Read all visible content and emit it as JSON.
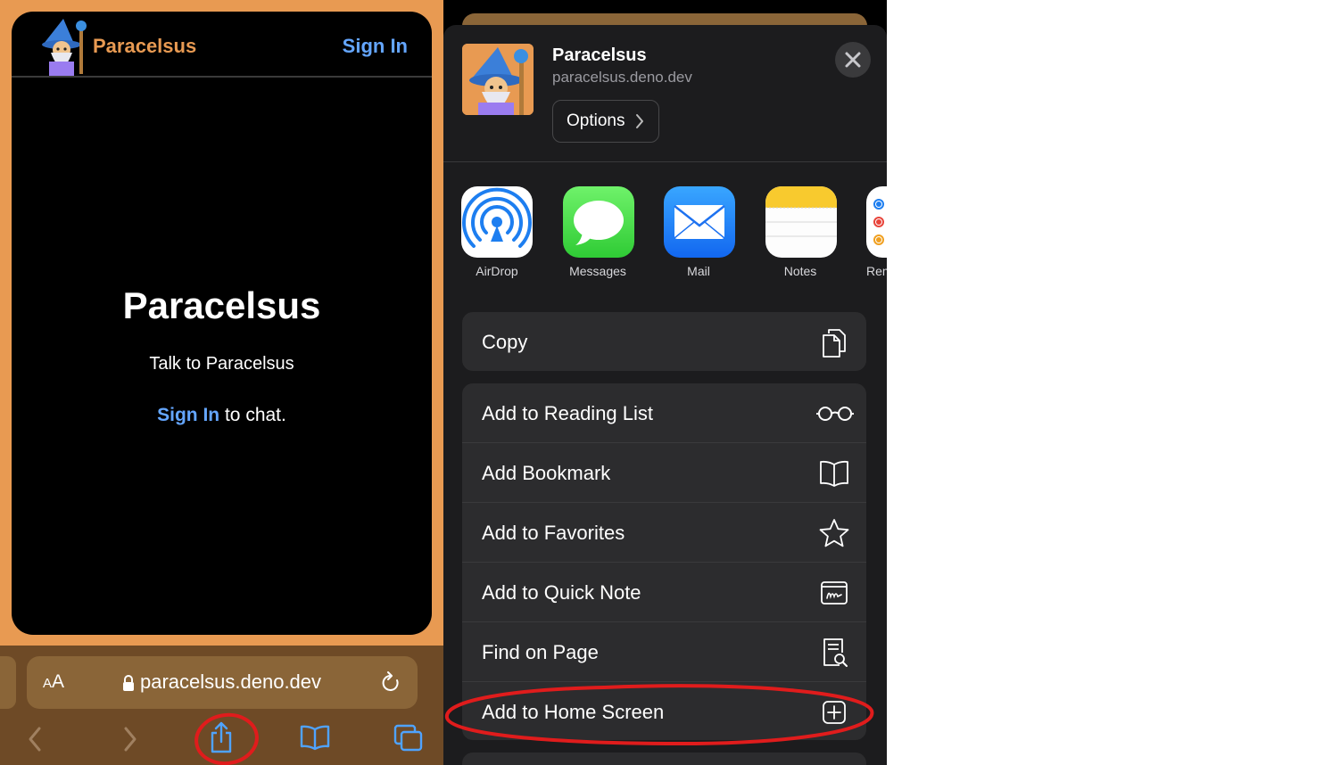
{
  "left": {
    "site": {
      "name": "Paracelsus",
      "header_signin": "Sign In",
      "hero_title": "Paracelsus",
      "hero_subtitle": "Talk to Paracelsus",
      "cta_link": "Sign In",
      "cta_suffix": " to chat."
    },
    "address_bar": {
      "aa_small": "A",
      "aa_large": "A",
      "url": "paracelsus.deno.dev"
    },
    "toolbar_icons": [
      "back-icon",
      "forward-icon",
      "share-icon",
      "bookmarks-icon",
      "tabs-icon"
    ]
  },
  "share_sheet": {
    "title": "Paracelsus",
    "url": "paracelsus.deno.dev",
    "options_label": "Options",
    "apps": [
      {
        "label": "AirDrop",
        "icon": "airdrop-icon"
      },
      {
        "label": "Messages",
        "icon": "messages-icon"
      },
      {
        "label": "Mail",
        "icon": "mail-icon"
      },
      {
        "label": "Notes",
        "icon": "notes-icon"
      },
      {
        "label": "Rem",
        "icon": "reminders-icon"
      }
    ],
    "actions_group1": [
      {
        "label": "Copy",
        "icon": "copy-icon"
      }
    ],
    "actions_group2": [
      {
        "label": "Add to Reading List",
        "icon": "glasses-icon"
      },
      {
        "label": "Add Bookmark",
        "icon": "book-icon"
      },
      {
        "label": "Add to Favorites",
        "icon": "star-icon"
      },
      {
        "label": "Add to Quick Note",
        "icon": "quick-note-icon"
      },
      {
        "label": "Find on Page",
        "icon": "find-on-page-icon"
      },
      {
        "label": "Add to Home Screen",
        "icon": "plus-square-icon"
      }
    ]
  },
  "colors": {
    "accent_orange": "#e89a52",
    "link_blue": "#64a6ff",
    "annotation_red": "#e01c1c"
  }
}
